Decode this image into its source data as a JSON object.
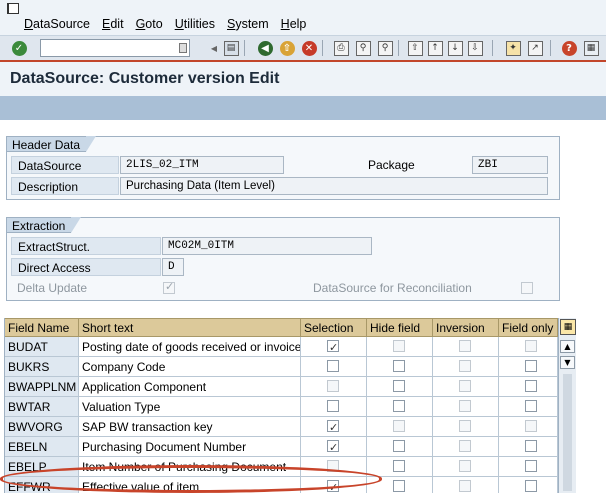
{
  "menu": [
    "DataSource",
    "Edit",
    "Goto",
    "Utilities",
    "System",
    "Help"
  ],
  "toolbar": {
    "command_value": "",
    "icons": [
      "enter-icon",
      "save-icon",
      "back-icon",
      "exit-icon",
      "cancel-icon",
      "print-icon",
      "find-icon",
      "find-next-icon",
      "first-page-icon",
      "prev-page-icon",
      "next-page-icon",
      "last-page-icon",
      "create-session-icon",
      "shortcut-icon",
      "help-icon",
      "customize-layout-icon"
    ]
  },
  "title": "DataSource: Customer version Edit",
  "header_data": {
    "group_label": "Header Data",
    "datasource_label": "DataSource",
    "datasource_value": "2LIS_02_ITM",
    "package_label": "Package",
    "package_value": "ZBI",
    "description_label": "Description",
    "description_value": "Purchasing Data (Item Level)"
  },
  "extraction": {
    "group_label": "Extraction",
    "extract_struct_label": "ExtractStruct.",
    "extract_struct_value": "MC02M_0ITM",
    "direct_access_label": "Direct Access",
    "direct_access_value": "D",
    "delta_update_label": "Delta Update",
    "delta_update_checked": true,
    "reconciliation_label": "DataSource for Reconciliation",
    "reconciliation_checked": false
  },
  "table": {
    "headers": [
      "Field Name",
      "Short text",
      "Selection",
      "Hide field",
      "Inversion",
      "Field only"
    ],
    "rows": [
      {
        "field": "BUDAT",
        "text": "Posting date of goods received or invoice",
        "selection": true,
        "hide": false,
        "inversion": false,
        "field_only": false,
        "enabled": [
          true,
          false,
          false,
          false
        ]
      },
      {
        "field": "BUKRS",
        "text": "Company Code",
        "selection": false,
        "hide": false,
        "inversion": false,
        "field_only": false,
        "enabled": [
          true,
          true,
          false,
          true
        ]
      },
      {
        "field": "BWAPPLNM",
        "text": "Application Component",
        "selection": false,
        "hide": false,
        "inversion": false,
        "field_only": false,
        "enabled": [
          false,
          true,
          false,
          true
        ]
      },
      {
        "field": "BWTAR",
        "text": "Valuation Type",
        "selection": false,
        "hide": false,
        "inversion": false,
        "field_only": false,
        "enabled": [
          true,
          true,
          false,
          true
        ]
      },
      {
        "field": "BWVORG",
        "text": "SAP BW transaction key",
        "selection": true,
        "hide": false,
        "inversion": false,
        "field_only": false,
        "enabled": [
          true,
          false,
          false,
          false
        ]
      },
      {
        "field": "EBELN",
        "text": "Purchasing Document Number",
        "selection": true,
        "hide": false,
        "inversion": false,
        "field_only": false,
        "enabled": [
          true,
          true,
          false,
          true
        ]
      },
      {
        "field": "EBELP",
        "text": "Item Number of Purchasing Document",
        "selection": false,
        "hide": false,
        "inversion": false,
        "field_only": false,
        "enabled": [
          false,
          true,
          false,
          true
        ]
      },
      {
        "field": "EFFWR",
        "text": "Effective value of item",
        "selection": true,
        "hide": false,
        "inversion": false,
        "field_only": false,
        "enabled": [
          true,
          true,
          false,
          true
        ]
      }
    ]
  },
  "colors": {
    "table_header": "#dcc99a",
    "highlight": "#c8442a",
    "app_toolbar": "#a9bfd6"
  }
}
